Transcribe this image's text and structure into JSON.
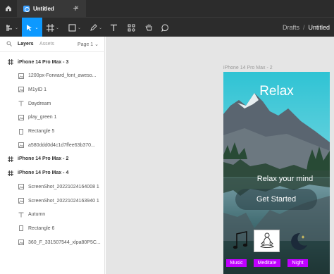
{
  "window": {
    "tab_title": "Untitled",
    "tab_close": "×",
    "add_tab": "+"
  },
  "toolbar": {
    "tools": [
      "frame-grid-icon",
      "cursor-move-icon",
      "frame-hash-icon",
      "rectangle-icon",
      "pen-icon",
      "text-icon",
      "components-icon",
      "hand-icon",
      "comment-icon"
    ],
    "selected_tool": "move",
    "breadcrumb": {
      "drafts": "Drafts",
      "separator": "/",
      "file": "Untitled"
    }
  },
  "layers_panel": {
    "tab_layers": "Layers",
    "tab_assets": "Assets",
    "page_selector": "Page 1 ⌄",
    "items": [
      {
        "label": "iPhone 14 Pro Max - 3",
        "type": "frame",
        "icon": "frame-icon"
      },
      {
        "label": "1200px-Forward_font_aweso...",
        "type": "child",
        "icon": "image-icon"
      },
      {
        "label": "M1yID 1",
        "type": "child",
        "icon": "image-icon"
      },
      {
        "label": "Daydream",
        "type": "child",
        "icon": "text-icon"
      },
      {
        "label": "play_green 1",
        "type": "child",
        "icon": "image-icon"
      },
      {
        "label": "Rectangle 5",
        "type": "child",
        "icon": "rectangle-icon"
      },
      {
        "label": "a580ddd0d4c1d7ffee63b370...",
        "type": "child",
        "icon": "image-icon"
      },
      {
        "label": "iPhone 14 Pro Max - 2",
        "type": "frame",
        "icon": "frame-icon"
      },
      {
        "label": "iPhone 14 Pro Max - 4",
        "type": "frame",
        "icon": "frame-icon"
      },
      {
        "label": "ScreenShot_20221024164008 1",
        "type": "child",
        "icon": "image-icon"
      },
      {
        "label": "ScreenShot_20221024163940 1",
        "type": "child",
        "icon": "image-icon"
      },
      {
        "label": "Autumn",
        "type": "child",
        "icon": "text-icon"
      },
      {
        "label": "Rectangle 6",
        "type": "child",
        "icon": "rectangle-icon"
      },
      {
        "label": "360_F_331507544_xlpa80P5C...",
        "type": "child",
        "icon": "image-icon"
      }
    ]
  },
  "canvas": {
    "frame_label": "iPhone 14 Pro Max - 2",
    "title": "Relax",
    "subtitle": "Relax your mind",
    "cta": "Get Started",
    "categories": [
      {
        "label": "Music",
        "icon": "music-note-icon"
      },
      {
        "label": "Meditate",
        "icon": "meditate-icon"
      },
      {
        "label": "Night",
        "icon": "moon-icon"
      }
    ],
    "accent_color": "#c000ff",
    "selection_color": "#0d99ff"
  }
}
